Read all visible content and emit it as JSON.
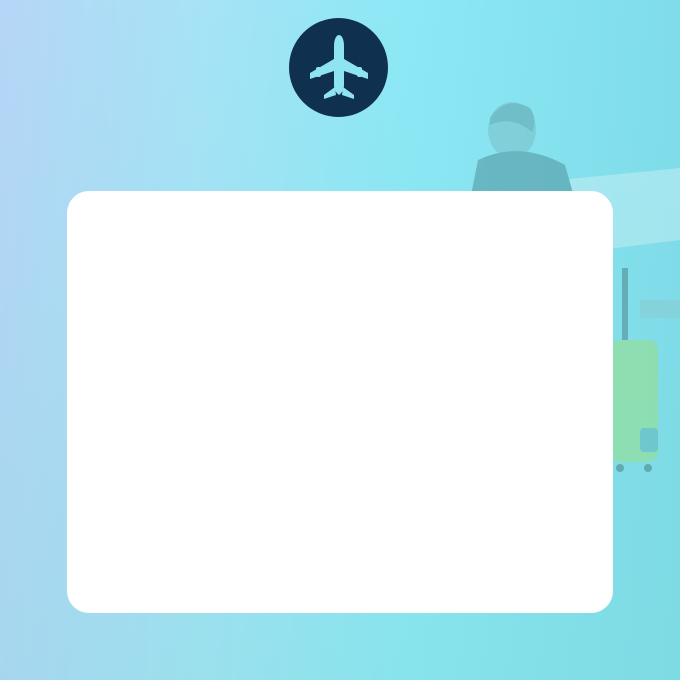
{
  "brand": {
    "icon": "airplane-icon",
    "circle_color": "#10304f",
    "icon_color": "#8fe4f4"
  },
  "background": {
    "subject": "traveler-with-luggage-near-aircraft",
    "tint_colors": [
      "#b6d6f7",
      "#8ce8f5",
      "#7fdcea"
    ]
  },
  "card": {
    "background_color": "#ffffff",
    "content": []
  }
}
